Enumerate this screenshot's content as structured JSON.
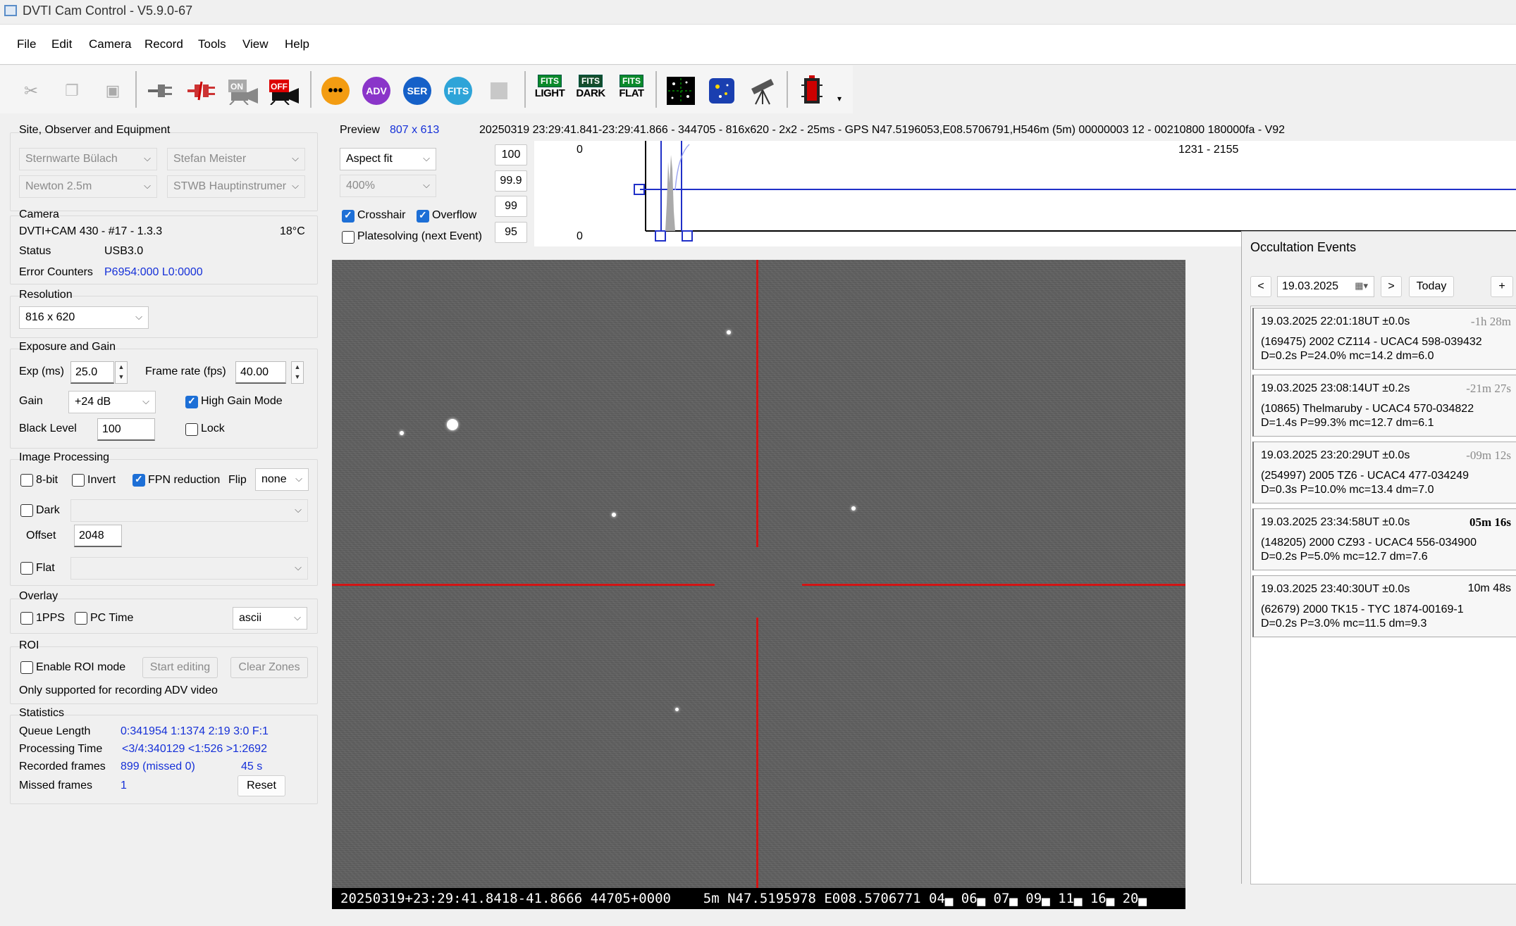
{
  "window": {
    "title": "DVTI Cam Control - V5.9.0-67"
  },
  "menu": [
    "File",
    "Edit",
    "Camera",
    "Record",
    "Tools",
    "View",
    "Help"
  ],
  "toolbar": {
    "icons": [
      "cut-icon",
      "copy-icon",
      "paste-icon",
      "connect-icon",
      "disconnect-icon",
      "camera-on-icon",
      "camera-off-icon",
      "record-more-icon",
      "adv-icon",
      "ser-icon",
      "fits-icon",
      "stop-icon",
      "fits-light-icon",
      "fits-dark-icon",
      "fits-flat-icon",
      "star-field-icon",
      "constellation-icon",
      "telescope-icon",
      "battery-icon"
    ],
    "circle_labels": {
      "adv": "ADV",
      "ser": "SER",
      "fits": "FITS"
    },
    "fits_top": "FITS",
    "fits_light": "LIGHT",
    "fits_dark": "DARK",
    "fits_flat": "FLAT",
    "on_label": "ON",
    "off_label": "OFF",
    "more": "▾"
  },
  "site": {
    "title": "Site, Observer and Equipment",
    "site": "Sternwarte Bülach",
    "observer": "Stefan Meister",
    "telescope": "Newton 2.5m",
    "instrument": "STWB Hauptinstrumer"
  },
  "camera": {
    "title": "Camera",
    "model": "DVTI+CAM 430  -  #17  -  1.3.3",
    "temp": "18°C",
    "status_label": "Status",
    "status_value": "USB3.0",
    "error_label": "Error Counters",
    "error_value": "P6954:000 L0:0000"
  },
  "resolution": {
    "title": "Resolution",
    "value": "816 x 620"
  },
  "exposure": {
    "title": "Exposure and Gain",
    "exp_label": "Exp (ms)",
    "exp_value": "25.0",
    "fps_label": "Frame rate (fps)",
    "fps_value": "40.00",
    "gain_label": "Gain",
    "gain_value": "+24 dB",
    "high_gain_label": "High Gain Mode",
    "high_gain_checked": true,
    "black_label": "Black Level",
    "black_value": "100",
    "lock_label": "Lock",
    "lock_checked": false
  },
  "processing": {
    "title": "Image Processing",
    "bit8_label": "8-bit",
    "invert_label": "Invert",
    "fpn_label": "FPN reduction",
    "fpn_checked": true,
    "flip_label": "Flip",
    "flip_value": "none",
    "dark_label": "Dark",
    "offset_label": "Offset",
    "offset_value": "2048",
    "flat_label": "Flat"
  },
  "overlay": {
    "title": "Overlay",
    "pps_label": "1PPS",
    "pctime_label": "PC Time",
    "format_value": "ascii"
  },
  "roi": {
    "title": "ROI",
    "enable_label": "Enable ROI mode",
    "start_label": "Start editing",
    "clear_label": "Clear Zones",
    "note": "Only supported for recording ADV video"
  },
  "statistics": {
    "title": "Statistics",
    "queue_label": "Queue Length",
    "queue_value": "0:341954  1:1374  2:19  3:0  F:1",
    "proc_label": "Processing Time",
    "proc_value": "<3/4:340129 <1:526  >1:2692",
    "rec_label": "Recorded frames",
    "rec_value": "899 (missed 0)",
    "rec_time": "45 s",
    "missed_label": "Missed frames",
    "missed_value": "1",
    "reset_label": "Reset"
  },
  "preview": {
    "label": "Preview",
    "size": "807 x 613",
    "info": "20250319 23:29:41.841-23:29:41.866 - 344705 - 816x620 - 2x2 - 25ms - GPS N47.5196053,E08.5706791,H546m (5m) 00000003 12 - 00210800 180000fa - V92",
    "fit_value": "Aspect fit",
    "zoom_value": "400%",
    "crosshair_label": "Crosshair",
    "crosshair_checked": true,
    "overflow_label": "Overflow",
    "overflow_checked": true,
    "plate_label": "Platesolving (next Event)",
    "levels": [
      "100",
      "99.9",
      "99",
      "95"
    ],
    "hist_top": "0",
    "hist_bottom": "0",
    "hist_range": "1231 - 2155"
  },
  "video": {
    "overlay_text": "20250319+23:29:41.8418-41.8666 44705+0000    5m N47.5195978 E008.5706771 04▄ 06▄ 07▄ 09▄ 11▄ 16▄ 20▄"
  },
  "occultation": {
    "title": "Occultation Events",
    "prev": "<",
    "date": "19.03.2025",
    "next": ">",
    "today": "Today",
    "add": "+",
    "events": [
      {
        "time": "19.03.2025 22:01:18UT ±0.0s",
        "rel": "-1h 28m",
        "obj": "(169475) 2002 CZ114 - UCAC4 598-039432",
        "params": "D=0.2s   P=24.0%   mc=14.2   dm=6.0",
        "future": false
      },
      {
        "time": "19.03.2025 23:08:14UT ±0.2s",
        "rel": "-21m 27s",
        "obj": "(10865) Thelmaruby - UCAC4 570-034822",
        "params": "D=1.4s   P=99.3%   mc=12.7   dm=6.1",
        "future": false
      },
      {
        "time": "19.03.2025 23:20:29UT ±0.0s",
        "rel": "-09m 12s",
        "obj": "(254997) 2005 TZ6 - UCAC4 477-034249",
        "params": "D=0.3s   P=10.0%   mc=13.4   dm=7.0",
        "future": false
      },
      {
        "time": "19.03.2025 23:34:58UT ±0.0s",
        "rel": "05m 16s",
        "obj": "(148205) 2000 CZ93 - UCAC4 556-034900",
        "params": "D=0.2s   P=5.0%   mc=12.7   dm=7.6",
        "future": true
      },
      {
        "time": "19.03.2025 23:40:30UT ±0.0s",
        "rel": "10m 48s",
        "obj": "(62679) 2000 TK15 - TYC 1874-00169-1",
        "params": "D=0.2s   P=3.0%   mc=11.5   dm=9.3",
        "future": true
      }
    ]
  }
}
